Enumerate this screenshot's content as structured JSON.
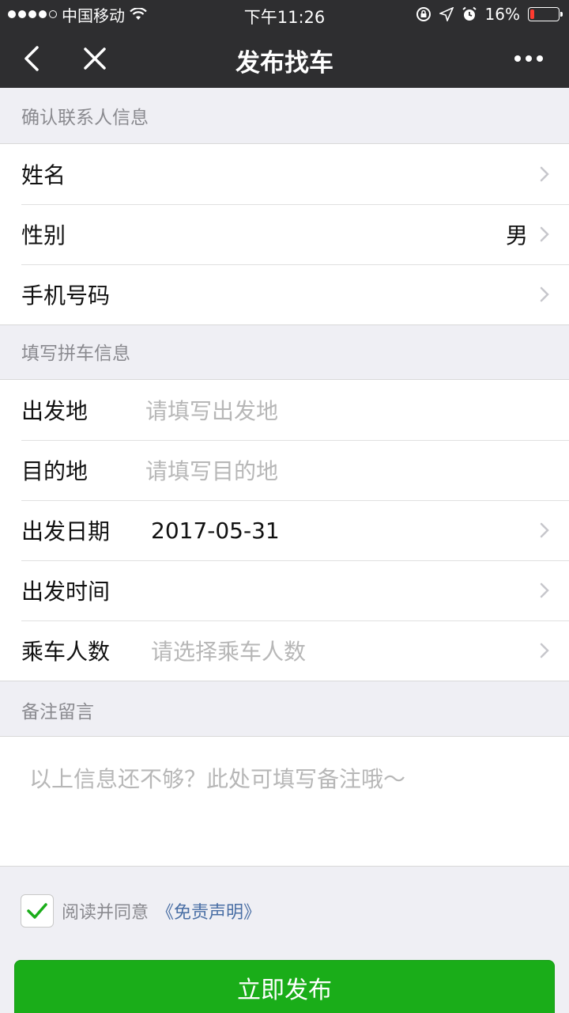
{
  "status_bar": {
    "carrier": "中国移动",
    "time": "下午11:26",
    "battery": "16%",
    "battery_level": 0.16,
    "icons": [
      "wifi-icon",
      "lock-rotation-icon",
      "location-arrow-icon",
      "alarm-icon",
      "battery-icon"
    ]
  },
  "nav": {
    "title": "发布找车",
    "icons": [
      "back-icon",
      "close-icon",
      "more-icon"
    ]
  },
  "contact": {
    "header": "确认联系人信息",
    "rows": [
      {
        "label": "姓名",
        "value": ""
      },
      {
        "label": "性别",
        "value": "男"
      },
      {
        "label": "手机号码",
        "value": ""
      }
    ]
  },
  "trip": {
    "header": "填写拼车信息",
    "rows": [
      {
        "label": "出发地",
        "placeholder": "请填写出发地"
      },
      {
        "label": "目的地",
        "placeholder": "请填写目的地"
      },
      {
        "label": "出发日期",
        "value": "2017-05-31"
      },
      {
        "label": "出发时间",
        "value": ""
      },
      {
        "label": "乘车人数",
        "placeholder": "请选择乘车人数"
      }
    ]
  },
  "remark": {
    "header": "备注留言",
    "placeholder": "以上信息还不够？此处可填写备注哦～"
  },
  "agreement": {
    "text": "阅读并同意",
    "link": "《免责声明》",
    "checked": true
  },
  "submit_label": "立即发布",
  "colors": {
    "nav_bg": "#2e2e30",
    "page_bg": "#efeff4",
    "accent_green": "#1aad19",
    "link_blue": "#4a6fa5",
    "placeholder": "#b7b7b7"
  }
}
